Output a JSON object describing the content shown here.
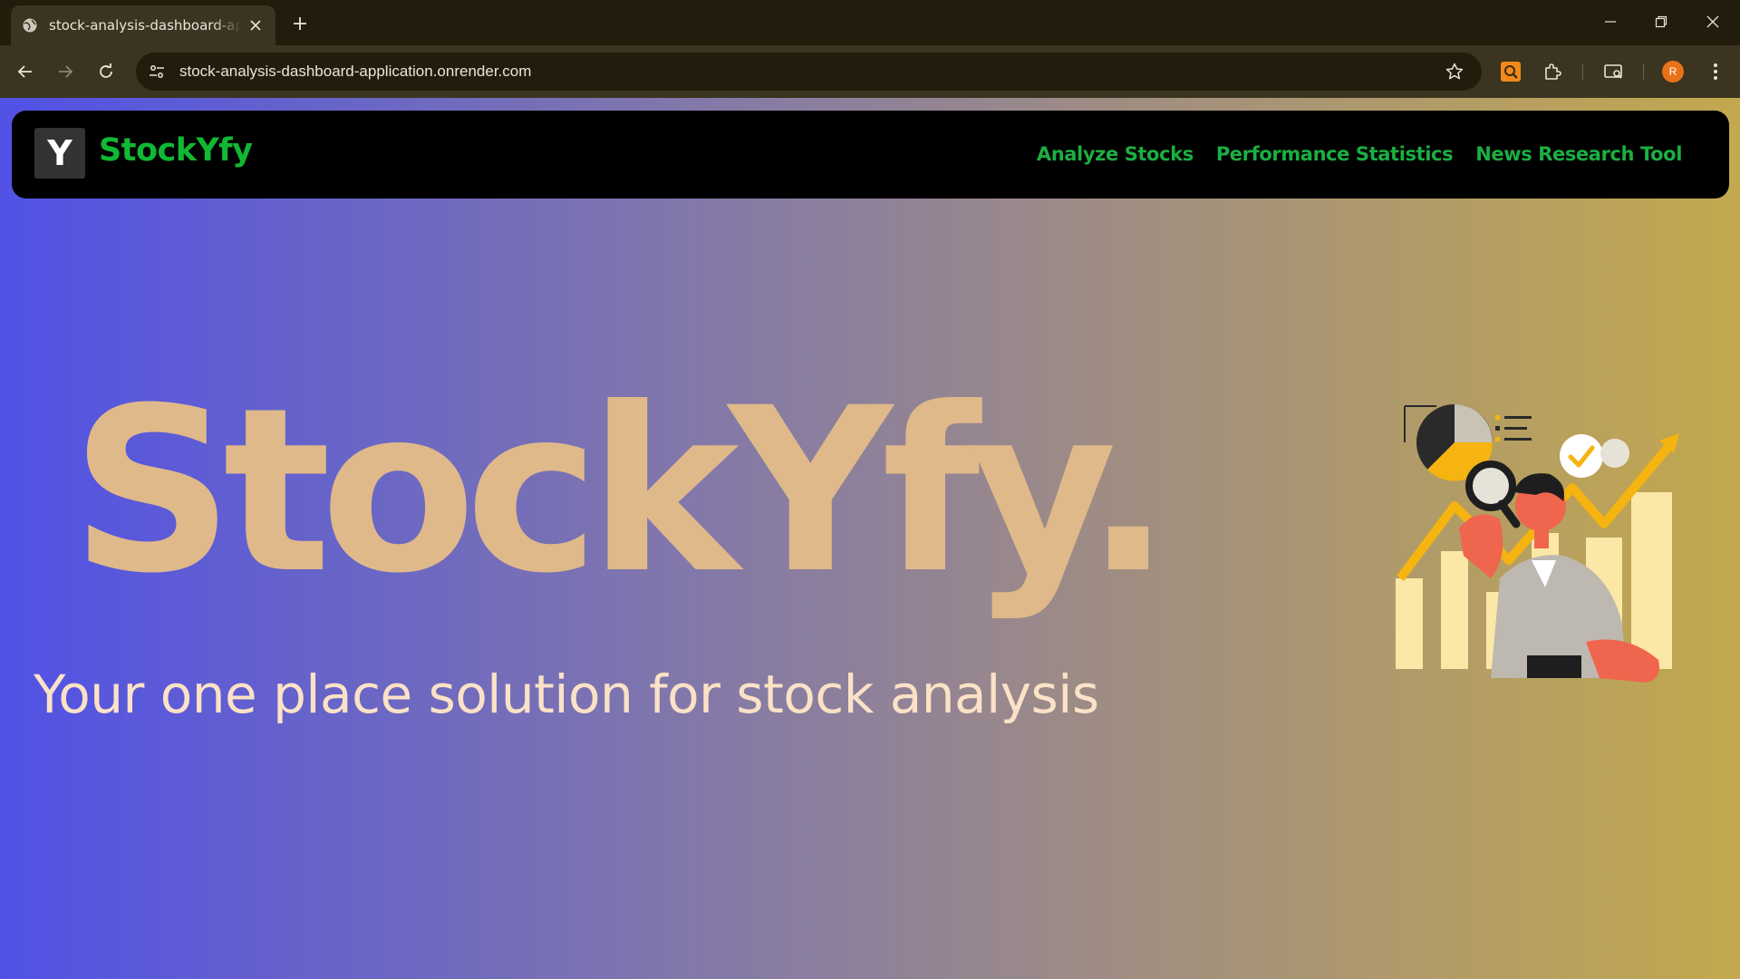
{
  "browser": {
    "tab_title": "stock-analysis-dashboard-application.onrender.com",
    "url": "stock-analysis-dashboard-application.onrender.com",
    "profile_initial": "R"
  },
  "site": {
    "logo_letter": "Y",
    "brand": "StockYfy",
    "nav": [
      "Analyze Stocks",
      "Performance Statistics",
      "News Research Tool"
    ],
    "hero_title": "StockYfy.",
    "tagline": "Your one place solution for stock analysis"
  },
  "colors": {
    "brand_green": "#11b833",
    "hero_text": "#dfb98a",
    "tagline_text": "#fbe2c6",
    "gradient_start": "#5151e6",
    "gradient_end": "#c2a84e"
  }
}
